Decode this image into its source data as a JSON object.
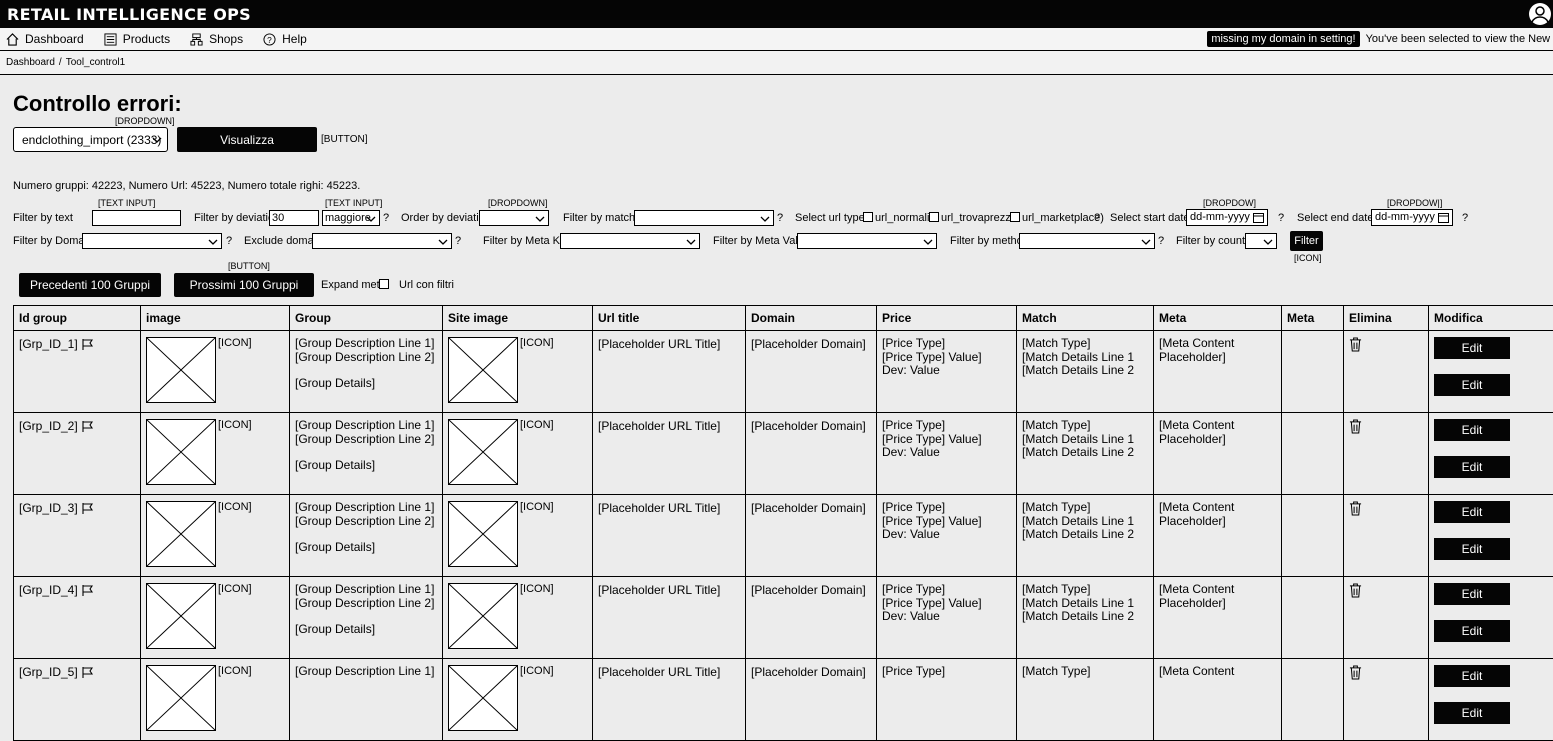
{
  "app": {
    "title": "RETAIL INTELLIGENCE OPS"
  },
  "nav": {
    "items": [
      {
        "label": "Dashboard",
        "icon": "home-icon"
      },
      {
        "label": "Products",
        "icon": "list-icon"
      },
      {
        "label": "Shops",
        "icon": "shops-icon"
      },
      {
        "label": "Help",
        "icon": "help-icon"
      }
    ],
    "badge": "missing my domain in setting!",
    "notice": "You've been selected to view the New Dashboard"
  },
  "breadcrumb": {
    "home": "Dashboard",
    "sep": "/",
    "current": "Tool_control1"
  },
  "page": {
    "title": "Controllo errori:",
    "dropdown_annotation": "[DROPDOWN]",
    "import_select": "endclothing_import (2333)",
    "visualizza": "Visualizza",
    "button_annotation": "[BUTTON]",
    "stats": "Numero gruppi: 42223, Numero Url: 45223, Numero totale righi: 45223."
  },
  "filters": {
    "text_input_ann": "[TEXT INPUT]",
    "dropdown_ann": "[DROPDOWN]",
    "dropdown_ann_alt": "[DROPDOW]",
    "dropdown_ann_alt2": "[DROPDOW|]",
    "icon_ann": "[ICON]",
    "q": "?",
    "filter_text": "Filter by text",
    "filter_deviation": "Filter by deviation",
    "deviation_value": "30",
    "deviation_op": "maggiore",
    "order_deviation": "Order by deviation",
    "filter_matcher": "Filter by matcher",
    "select_url_type": "Select url type",
    "url_normali": "url_normali",
    "url_trovaprezzi": "url_trovaprezzi",
    "url_marketplace": "url_marketplace)",
    "start_date": "Select start date",
    "end_date": "Select end date",
    "date_placeholder": "dd-mm-yyyy",
    "filter_domain": "Filter by Domain",
    "exclude_domain": "Exclude domain",
    "filter_meta_key": "Filter by Meta Key",
    "filter_meta_value": "Filter by Meta Value",
    "filter_method": "Filter by method",
    "filter_country": "Filter by country",
    "filter_button": "Filter"
  },
  "pager": {
    "prev": "Precedenti 100 Gruppi",
    "next": "Prossimi 100 Gruppi",
    "expand_meta": "Expand meta",
    "url_filtri": "Url con filtri"
  },
  "table": {
    "headers": [
      "Id group",
      "image",
      "Group",
      "Site image",
      "Url title",
      "Domain",
      "Price",
      "Match",
      "Meta",
      "Meta",
      "Elimina",
      "Modifica"
    ],
    "icon_ann": "[ICON]",
    "edit": "Edit",
    "rows": [
      {
        "id": "[Grp_ID_1]",
        "g1": "[Group Description Line 1]",
        "g2": "[Group Description Line 2]",
        "gd": "[Group Details]",
        "url": "[Placeholder URL Title]",
        "domain": "[Placeholder Domain]",
        "p1": "[Price Type]",
        "p2": "[Price Type] Value]",
        "p3": "Dev: Value",
        "m1": "[Match Type]",
        "m2": "[Match Details Line 1",
        "m3": "[Match Details Line 2",
        "meta1": "[Meta Content",
        "meta2": "Placeholder]"
      },
      {
        "id": "[Grp_ID_2]",
        "g1": "[Group Description Line 1]",
        "g2": "[Group Description Line 2]",
        "gd": "[Group Details]",
        "url": "[Placeholder URL Title]",
        "domain": "[Placeholder Domain]",
        "p1": "[Price Type]",
        "p2": "[Price Type] Value]",
        "p3": "Dev: Value",
        "m1": "[Match Type]",
        "m2": "[Match Details Line 1",
        "m3": "[Match Details Line 2",
        "meta1": "[Meta Content",
        "meta2": "Placeholder]"
      },
      {
        "id": "[Grp_ID_3]",
        "g1": "[Group Description Line 1]",
        "g2": "[Group Description Line 2]",
        "gd": "[Group Details]",
        "url": "[Placeholder URL Title]",
        "domain": "[Placeholder Domain]",
        "p1": "[Price Type]",
        "p2": "[Price Type] Value]",
        "p3": "Dev: Value",
        "m1": "[Match Type]",
        "m2": "[Match Details Line 1",
        "m3": "[Match Details Line 2",
        "meta1": "[Meta Content",
        "meta2": "Placeholder]"
      },
      {
        "id": "[Grp_ID_4]",
        "g1": "[Group Description Line 1]",
        "g2": "[Group Description Line 2]",
        "gd": "[Group Details]",
        "url": "[Placeholder URL Title]",
        "domain": "[Placeholder Domain]",
        "p1": "[Price Type]",
        "p2": "[Price Type] Value]",
        "p3": "Dev: Value",
        "m1": "[Match Type]",
        "m2": "[Match Details Line 1",
        "m3": "[Match Details Line 2",
        "meta1": "[Meta Content",
        "meta2": "Placeholder]"
      },
      {
        "id": "[Grp_ID_5]",
        "g1": "[Group Description Line 1]",
        "g2": "",
        "gd": "",
        "url": "[Placeholder URL Title]",
        "domain": "[Placeholder Domain]",
        "p1": "[Price Type]",
        "p2": "",
        "p3": "",
        "m1": "[Match Type]",
        "m2": "",
        "m3": "",
        "meta1": "[Meta Content",
        "meta2": ""
      }
    ]
  }
}
